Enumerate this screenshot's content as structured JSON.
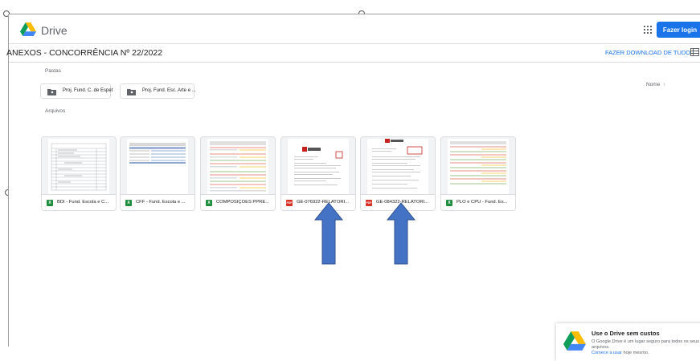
{
  "header": {
    "app_name": "Drive",
    "login_label": "Fazer login"
  },
  "titlebar": {
    "title": "ANEXOS - CONCORRÊNCIA Nº 22/2022",
    "download_label": "FAZER DOWNLOAD DE TUDO"
  },
  "folders_section": {
    "label": "Pastas",
    "sort_label": "Nome",
    "sort_arrow": "↑"
  },
  "folders": [
    {
      "name": "Proj. Fund. C. de Espet"
    },
    {
      "name": "Proj. Fund. Esc. Arte e ..."
    }
  ],
  "files_section": {
    "label": "Arquivos"
  },
  "files": [
    {
      "name": "BDI - Fund. Escola e C...",
      "type": "xls",
      "type_glyph": "X"
    },
    {
      "name": "CFF - Fund. Escola e ...",
      "type": "xls",
      "type_glyph": "X"
    },
    {
      "name": "COMPOSIÇÕES PPRE...",
      "type": "xls",
      "type_glyph": "X"
    },
    {
      "name": "GE-076922-RELATÓRI...",
      "type": "pdf",
      "type_glyph": "PDF"
    },
    {
      "name": "GE-084322-RELATÓRI...",
      "type": "pdf",
      "type_glyph": "PDF"
    },
    {
      "name": "PLO e CPU - Fund. Es...",
      "type": "xls",
      "type_glyph": "X"
    }
  ],
  "toast": {
    "title": "Use o Drive sem custos",
    "body": "O Google Drive é um lugar seguro para todos os seus arquivos.",
    "link": "Comece a usar",
    "link_suffix": " hoje mesmo.",
    "close": "×"
  },
  "colors": {
    "accent": "#1a73e8",
    "arrow_fill": "#4472c4",
    "arrow_stroke": "#2f528f",
    "excel": "#1e8e3e",
    "pdf": "#d93025"
  }
}
